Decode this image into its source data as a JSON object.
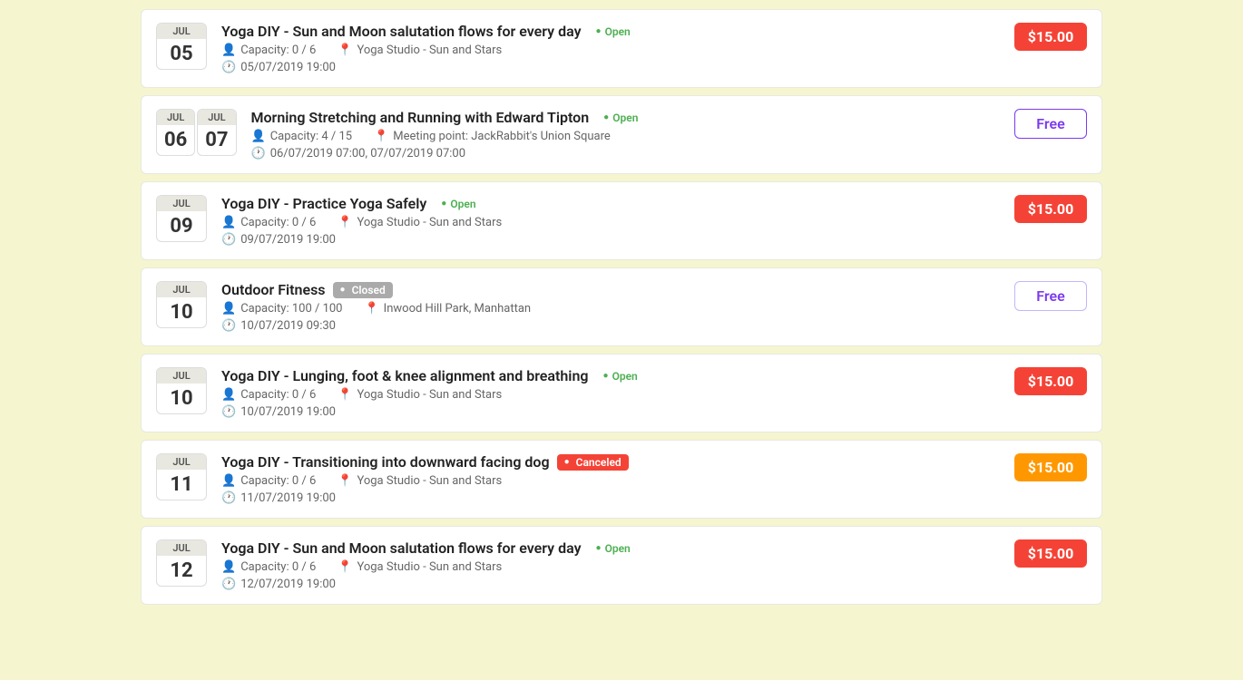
{
  "events": [
    {
      "id": 1,
      "month": "JUL",
      "day": "05",
      "title": "Yoga DIY - Sun and Moon salutation flows for every day",
      "status": "Open",
      "status_type": "open",
      "capacity": "0 / 6",
      "location": "Yoga Studio - Sun and Stars",
      "datetime": "05/07/2019 19:00",
      "price": "$15.00",
      "price_type": "paid",
      "dual_date": false
    },
    {
      "id": 2,
      "month1": "JUL",
      "month2": "JUL",
      "day1": "06",
      "day2": "07",
      "title": "Morning Stretching and Running with Edward Tipton",
      "status": "Open",
      "status_type": "open",
      "capacity": "4 / 15",
      "location": "Meeting point: JackRabbit's Union Square",
      "datetime": "06/07/2019 07:00, 07/07/2019 07:00",
      "price": "Free",
      "price_type": "free",
      "dual_date": true
    },
    {
      "id": 3,
      "month": "JUL",
      "day": "09",
      "title": "Yoga DIY - Practice Yoga Safely",
      "status": "Open",
      "status_type": "open",
      "capacity": "0 / 6",
      "location": "Yoga Studio - Sun and Stars",
      "datetime": "09/07/2019 19:00",
      "price": "$15.00",
      "price_type": "paid",
      "dual_date": false
    },
    {
      "id": 4,
      "month": "JUL",
      "day": "10",
      "title": "Outdoor Fitness",
      "status": "Closed",
      "status_type": "closed",
      "capacity": "100 / 100",
      "location": "Inwood Hill Park, Manhattan",
      "datetime": "10/07/2019 09:30",
      "price": "Free",
      "price_type": "free-outline",
      "dual_date": false
    },
    {
      "id": 5,
      "month": "JUL",
      "day": "10",
      "title": "Yoga DIY - Lunging, foot & knee alignment and breathing",
      "status": "Open",
      "status_type": "open",
      "capacity": "0 / 6",
      "location": "Yoga Studio - Sun and Stars",
      "datetime": "10/07/2019 19:00",
      "price": "$15.00",
      "price_type": "paid",
      "dual_date": false
    },
    {
      "id": 6,
      "month": "JUL",
      "day": "11",
      "title": "Yoga DIY - Transitioning into downward facing dog",
      "status": "Canceled",
      "status_type": "canceled",
      "capacity": "0 / 6",
      "location": "Yoga Studio - Sun and Stars",
      "datetime": "11/07/2019 19:00",
      "price": "$15.00",
      "price_type": "paid-yellow",
      "dual_date": false
    },
    {
      "id": 7,
      "month": "JUL",
      "day": "12",
      "title": "Yoga DIY - Sun and Moon salutation flows for every day",
      "status": "Open",
      "status_type": "open",
      "capacity": "0 / 6",
      "location": "Yoga Studio - Sun and Stars",
      "datetime": "12/07/2019 19:00",
      "price": "$15.00",
      "price_type": "paid",
      "dual_date": false
    }
  ]
}
